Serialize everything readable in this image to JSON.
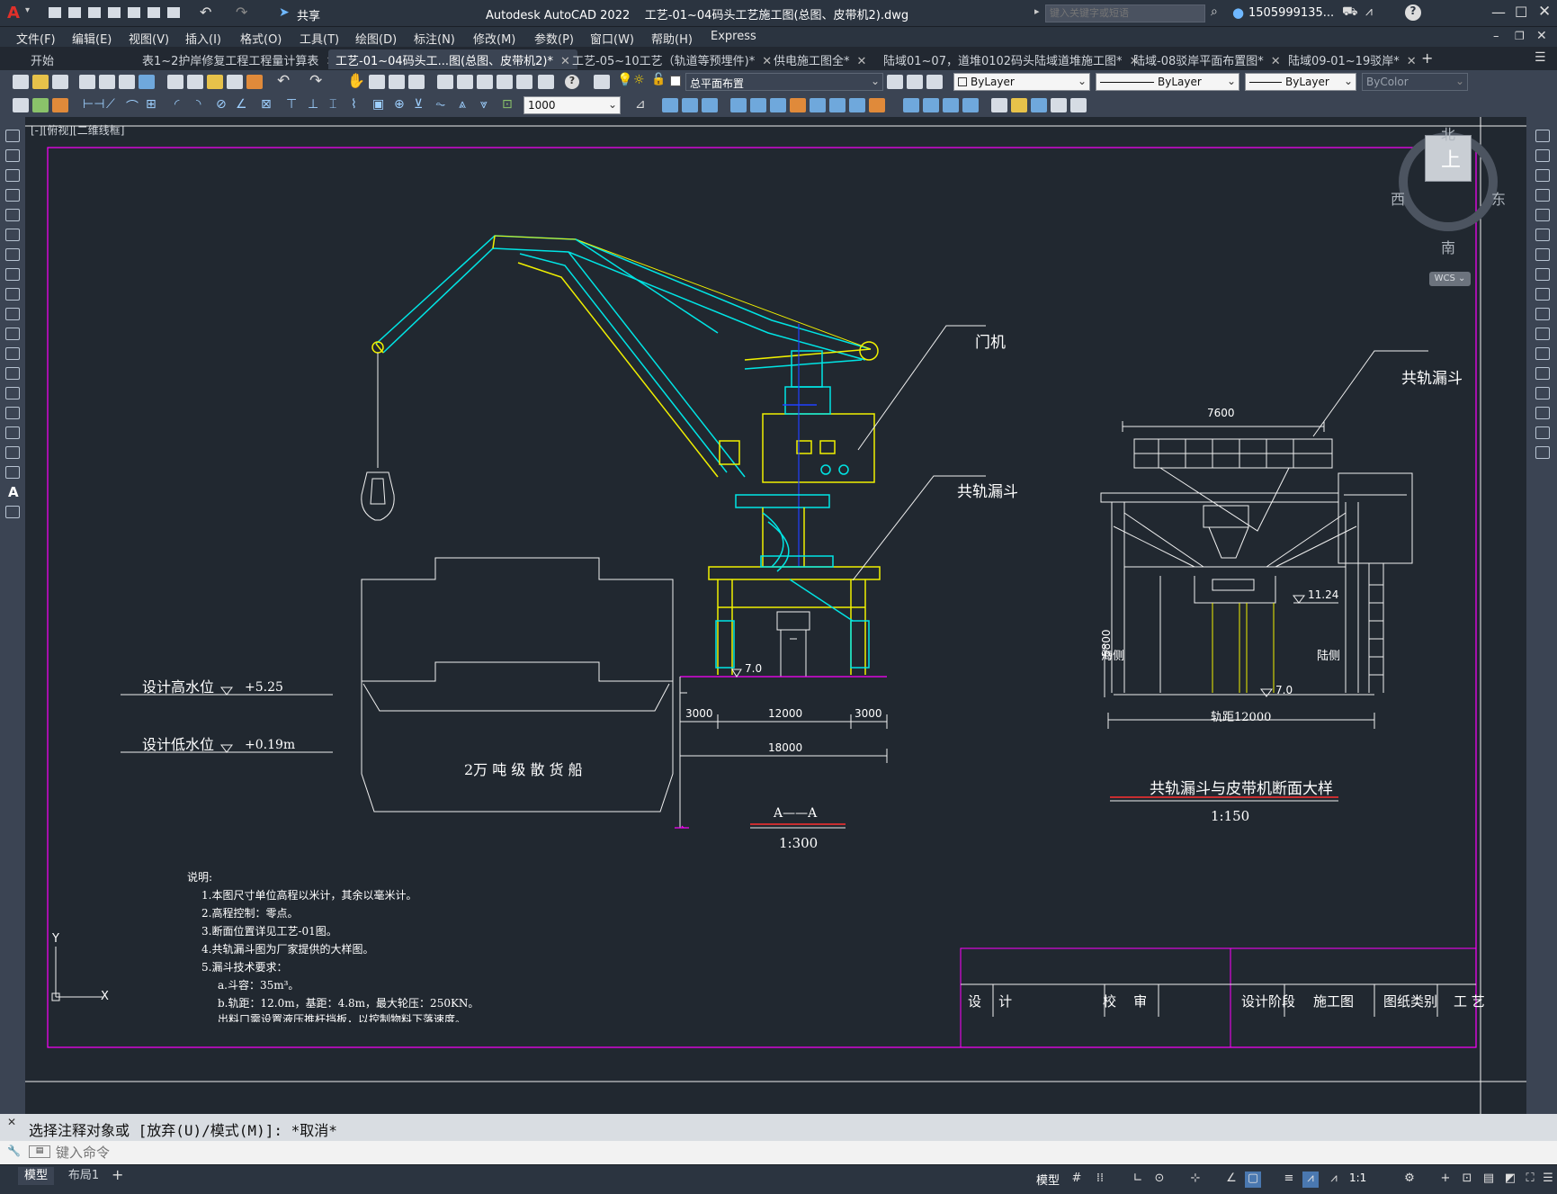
{
  "titlebar": {
    "app_logo": "A",
    "share_label": "共享",
    "title": "Autodesk AutoCAD 2022    工艺-01~04码头工艺施工图(总图、皮带机2).dwg",
    "search_placeholder": "键入关键字或短语",
    "user": "1505999135...",
    "help": "?"
  },
  "menubar": {
    "items": [
      "文件(F)",
      "编辑(E)",
      "视图(V)",
      "插入(I)",
      "格式(O)",
      "工具(T)",
      "绘图(D)",
      "标注(N)",
      "修改(M)",
      "参数(P)",
      "窗口(W)",
      "帮助(H)",
      "Express"
    ]
  },
  "tabs": [
    {
      "label": "开始",
      "active": false
    },
    {
      "label": "表1~2护岸修复工程工程量计算表",
      "active": false
    },
    {
      "label": "工艺-01~04码头工...图(总图、皮带机2)*",
      "active": true
    },
    {
      "label": "工艺-05~10工艺（轨道等预埋件)*",
      "active": false
    },
    {
      "label": "供电施工图全*",
      "active": false
    },
    {
      "label": "陆域01~07，道堆0102码头陆域道堆施工图*",
      "active": false
    },
    {
      "label": "陆域-08驳岸平面布置图*",
      "active": false
    },
    {
      "label": "陆域09-01~19驳岸*",
      "active": false
    }
  ],
  "toolbar1": {
    "layer": "总平面布置",
    "color": "ByLayer",
    "linetype": "ByLayer",
    "lineweight": "ByLayer",
    "plotstyle": "ByColor"
  },
  "toolbar2": {
    "scale": "1000"
  },
  "viewport": {
    "label": "[-][俯视][二维线框]"
  },
  "viewcube": {
    "north": "北",
    "south": "南",
    "east": "东",
    "west": "西",
    "top": "上",
    "wcs": "WCS"
  },
  "drawing": {
    "crane_label": "门机",
    "hopper_label_1": "共轨漏斗",
    "hopper_label_2": "共轨漏斗",
    "ship_label": "2万 吨 级 散 货 船",
    "high_water": "设计高水位",
    "high_water_val": "+5.25",
    "low_water": "设计低水位",
    "low_water_val": "+0.19m",
    "elev_7_left": "7.0",
    "dim_3000a": "3000",
    "dim_12000": "12000",
    "dim_3000b": "3000",
    "dim_18000": "18000",
    "section_title": "A——A",
    "section_scale": "1:300",
    "dim_7600": "7600",
    "elev_1124": "11.24",
    "dim_5800": "5800",
    "sea_side": "海侧",
    "land_side": "陆侧",
    "elev_7_right": "7.0",
    "gauge": "轨距12000",
    "detail_title": "共轨漏斗与皮带机断面大样",
    "detail_scale": "1:150",
    "notes_title": "说明:",
    "notes": [
      "1.本图尺寸单位高程以米计，其余以毫米计。",
      "2.高程控制：零点。",
      "3.断面位置详见工艺-01图。",
      "4.共轨漏斗图为厂家提供的大样图。",
      "5.漏斗技术要求：",
      "a.斗容：35m³。",
      "b.轨距：12.0m，基距：4.8m，最大轮压：250KN。",
      "出料口需设置液压推杆挡板，以控制物料下落速度。"
    ],
    "title_block": {
      "design": "设    计",
      "review": "校    审",
      "stage_label": "设计阶段",
      "stage_val": "施工图",
      "category_label": "图纸类别",
      "category_val": "工 艺"
    },
    "ucs_x": "X",
    "ucs_y": "Y"
  },
  "command": {
    "history": "选择注释对象或 [放弃(U)/模式(M)]: *取消*",
    "placeholder": "键入命令"
  },
  "statusbar": {
    "layout_tabs": [
      "模型",
      "布局1"
    ],
    "model_label": "模型",
    "scale": "1:1"
  },
  "colors": {
    "canvas_bg": "#212830",
    "cyan": "#00e5e5",
    "yellow": "#f0f000",
    "magenta": "#ff00ff",
    "red": "#ff3030",
    "white": "#f0f0f0",
    "blue": "#2040ff"
  }
}
